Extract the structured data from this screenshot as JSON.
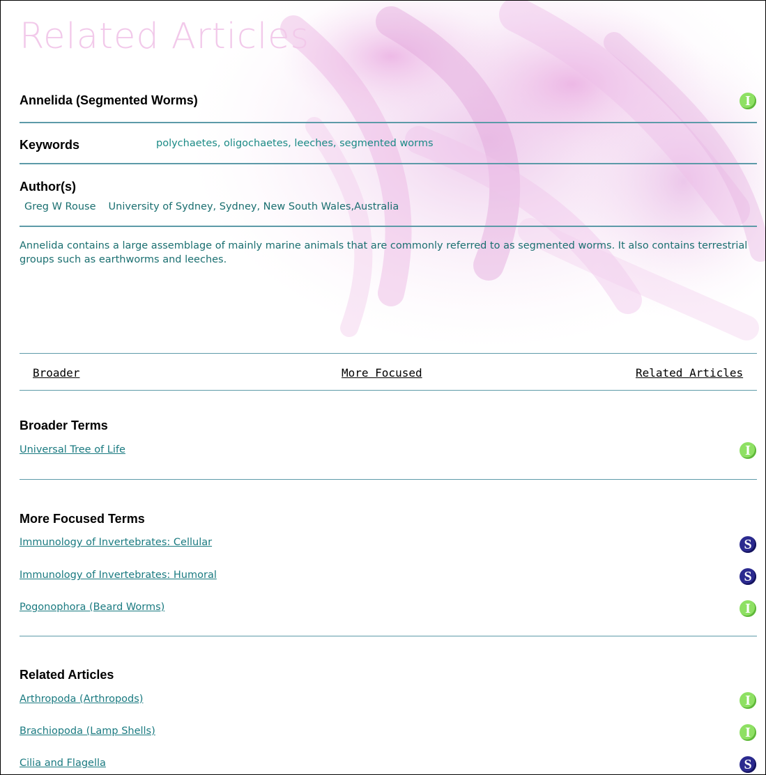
{
  "header": {
    "title": "Related Articles"
  },
  "article": {
    "title": "Annelida (Segmented Worms)",
    "title_badge": "I",
    "keywords_label": "Keywords",
    "keywords": "polychaetes, oligochaetes, leeches, segmented worms",
    "authors_label": "Author(s)",
    "author_name": "Greg W Rouse",
    "author_affiliation": "University of Sydney, Sydney, New South Wales,Australia",
    "abstract": "Annelida contains a large assemblage of mainly marine animals that are commonly referred to as segmented worms. It also contains terrestrial groups such as earthworms and leeches."
  },
  "nav": {
    "broader": "Broader",
    "more_focused": "More Focused",
    "related": "Related Articles"
  },
  "broader_terms": {
    "heading": "Broader Terms",
    "items": [
      {
        "label": "Universal Tree of Life",
        "badge": "I"
      }
    ]
  },
  "focused_terms": {
    "heading": "More Focused Terms",
    "items": [
      {
        "label": "Immunology of Invertebrates: Cellular",
        "badge": "S"
      },
      {
        "label": "Immunology of Invertebrates: Humoral",
        "badge": "S"
      },
      {
        "label": "Pogonophora (Beard Worms)",
        "badge": "I"
      }
    ]
  },
  "related_articles": {
    "heading": "Related Articles",
    "items": [
      {
        "label": "Arthropoda (Arthropods)",
        "badge": "I"
      },
      {
        "label": "Brachiopoda (Lamp Shells)",
        "badge": "I"
      },
      {
        "label": "Cilia and Flagella",
        "badge": "S"
      }
    ]
  },
  "colors": {
    "title_pink": "#f2c9ea",
    "rule_teal": "#5c9aa8",
    "link_teal": "#1a7a80",
    "badge_intro_green": "#8ee063",
    "badge_standard_navy": "#2b2a8f"
  },
  "icons": {
    "I": "intro-badge-icon",
    "S": "standard-badge-icon"
  }
}
